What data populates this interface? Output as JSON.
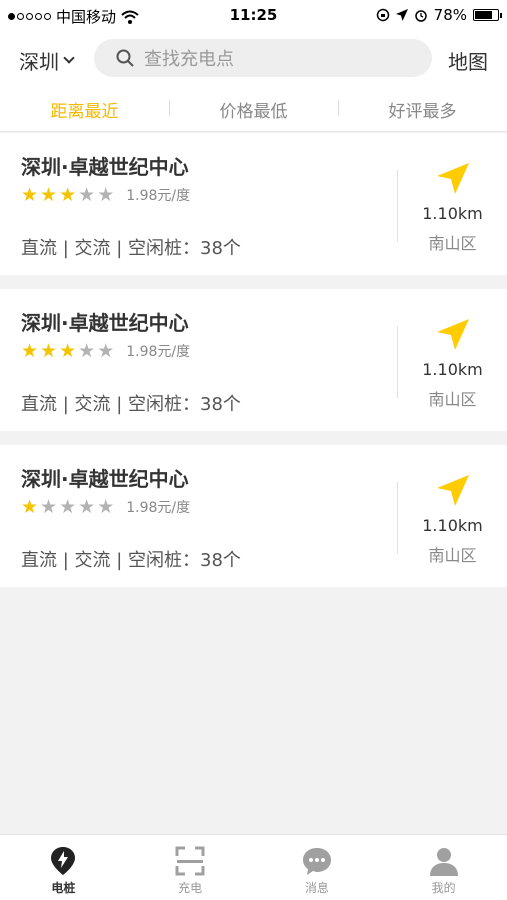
{
  "status_bar": {
    "carrier": "中国移动",
    "time": "11:25",
    "battery": "78%",
    "battery_level": 0.78
  },
  "header": {
    "city": "深圳",
    "search_placeholder": "查找充电点",
    "map_label": "地图"
  },
  "sort_tabs": [
    {
      "label": "距离最近",
      "active": true
    },
    {
      "label": "价格最低",
      "active": false
    },
    {
      "label": "好评最多",
      "active": false
    }
  ],
  "stations": [
    {
      "name": "深圳·卓越世纪中心",
      "rating": 3,
      "price": "1.98元/度",
      "info": "直流 | 交流 | 空闲桩：38个",
      "distance": "1.10km",
      "district": "南山区"
    },
    {
      "name": "深圳·卓越世纪中心",
      "rating": 3,
      "price": "1.98元/度",
      "info": "直流 | 交流 | 空闲桩：38个",
      "distance": "1.10km",
      "district": "南山区"
    },
    {
      "name": "深圳·卓越世纪中心",
      "rating": 1,
      "price": "1.98元/度",
      "info": "直流 | 交流 | 空闲桩：38个",
      "distance": "1.10km",
      "district": "南山区"
    }
  ],
  "bottom_tabs": [
    {
      "label": "电桩",
      "icon": "charging-pile-icon",
      "active": true
    },
    {
      "label": "充电",
      "icon": "scan-icon",
      "active": false
    },
    {
      "label": "消息",
      "icon": "message-icon",
      "active": false
    },
    {
      "label": "我的",
      "icon": "profile-icon",
      "active": false
    }
  ],
  "colors": {
    "accent": "#f5b800",
    "star_on": "#f5c400",
    "star_off": "#b3b3b3",
    "background": "#f2f2f2"
  }
}
